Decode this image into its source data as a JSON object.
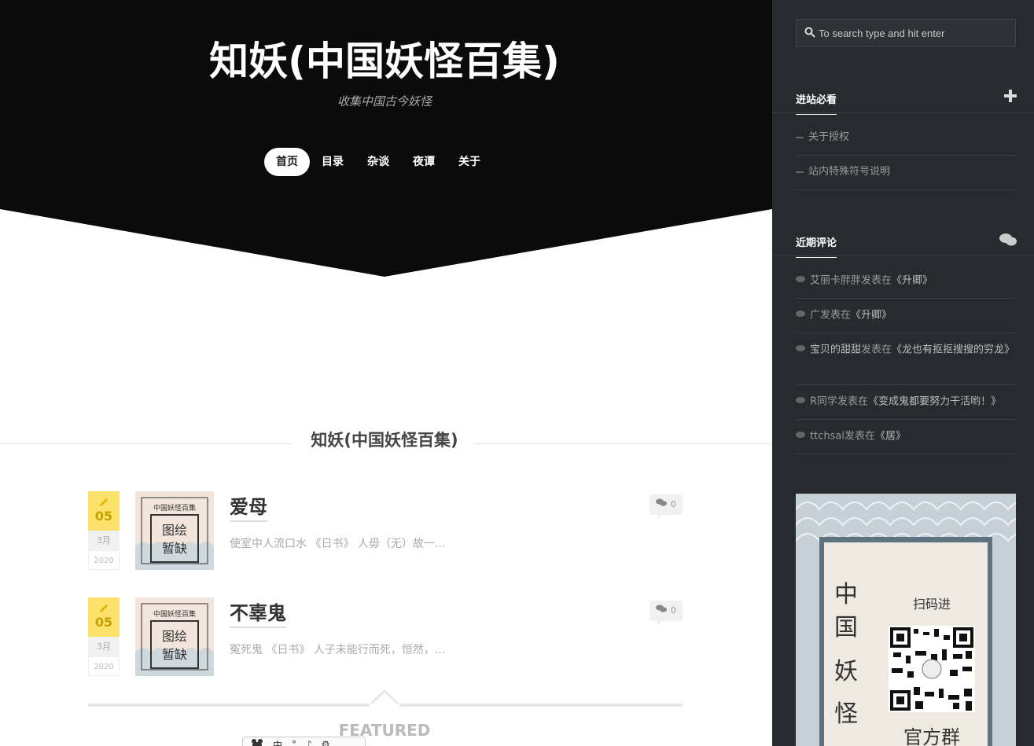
{
  "header": {
    "title": "知妖(中国妖怪百集)",
    "description": "收集中国古今妖怪"
  },
  "nav": {
    "items": [
      "首页",
      "目录",
      "杂谈",
      "夜谭",
      "关于"
    ],
    "active": "首页"
  },
  "section": {
    "title": "知妖(中国妖怪百集)"
  },
  "posts": [
    {
      "day": "05",
      "month": "3月",
      "year": "2020",
      "title": "爱母",
      "excerpt": "使室中人流口水 《日书》 人毋（无）故一...",
      "comments": "0",
      "thumb_lines": [
        "中国妖怪百集",
        "图绘",
        "暂缺"
      ]
    },
    {
      "day": "05",
      "month": "3月",
      "year": "2020",
      "title": "不辜鬼",
      "excerpt": "冤死鬼 《日书》 人子未能行而死，恒然，...",
      "comments": "0",
      "thumb_lines": [
        "中国妖怪百集",
        "图绘",
        "暂缺"
      ]
    }
  ],
  "featured": "FEATURED",
  "toolbar": {
    "items": [
      "中",
      "°",
      "♪",
      "⚙"
    ]
  },
  "sidebar": {
    "search_placeholder": "To search type and hit enter",
    "widget1": {
      "title": "进站必看",
      "icon": "plus-icon",
      "items": [
        "关于授权",
        "站内特殊符号说明"
      ]
    },
    "widget2": {
      "title": "近期评论",
      "icon": "comments-icon",
      "items": [
        {
          "author": "艾丽卡胖胖",
          "sep": "发表在",
          "link": "《升卿》"
        },
        {
          "author": "广",
          "sep": "发表在",
          "link": "《升卿》"
        },
        {
          "author": "宝贝的甜甜",
          "sep": "发表在",
          "link": "《龙也有抠抠搜搜的穷龙》"
        },
        {
          "author": "R同学",
          "sep": "发表在",
          "link": "《变成鬼都要努力干活哟！》"
        },
        {
          "author": "ttchsal",
          "sep": "发表在",
          "link": "《居》"
        }
      ]
    },
    "qr_card": {
      "vertical_text": "中国妖怪",
      "scan_text": "扫码进",
      "group_text": "官方群"
    }
  },
  "colors": {
    "header_bg": "#0b0b0b",
    "sidebar_bg": "#272b2f",
    "date_yellow": "#fbe26a"
  }
}
